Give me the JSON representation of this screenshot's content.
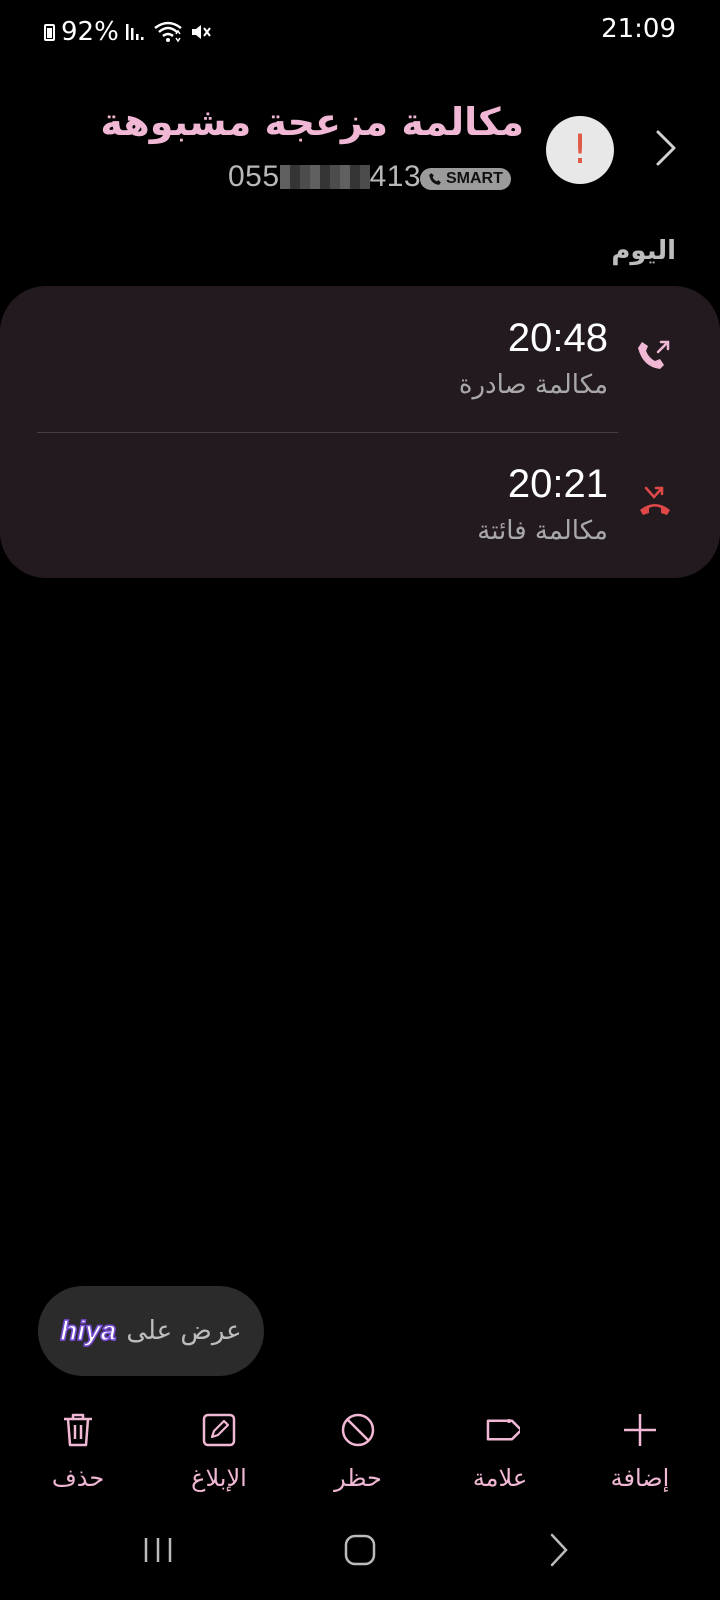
{
  "status_bar": {
    "battery": "92%",
    "time": "21:09",
    "icons": [
      "battery-icon",
      "signal-icon",
      "wifi-icon",
      "mute-icon"
    ]
  },
  "header": {
    "title": "مكالمة مزعجة مشبوهة",
    "smart_badge": "SMART",
    "phone_prefix": "055",
    "phone_suffix": "413",
    "warn_glyph": "!"
  },
  "section_label": "اليوم",
  "calls": [
    {
      "time": "20:48",
      "type": "مكالمة صادرة",
      "icon": "outgoing-call-icon"
    },
    {
      "time": "20:21",
      "type": "مكالمة فائتة",
      "icon": "missed-call-icon"
    }
  ],
  "hiya": {
    "text": "عرض على",
    "logo": "hiya"
  },
  "actions": [
    {
      "label": "حذف",
      "icon": "trash-icon"
    },
    {
      "label": "الإبلاغ",
      "icon": "edit-icon"
    },
    {
      "label": "حظر",
      "icon": "block-icon"
    },
    {
      "label": "علامة",
      "icon": "tag-icon"
    },
    {
      "label": "إضافة",
      "icon": "plus-icon"
    }
  ],
  "colors": {
    "accent": "#f0b8d4",
    "card_bg": "#231a20",
    "missed": "#e04848",
    "warn": "#e05a48"
  }
}
